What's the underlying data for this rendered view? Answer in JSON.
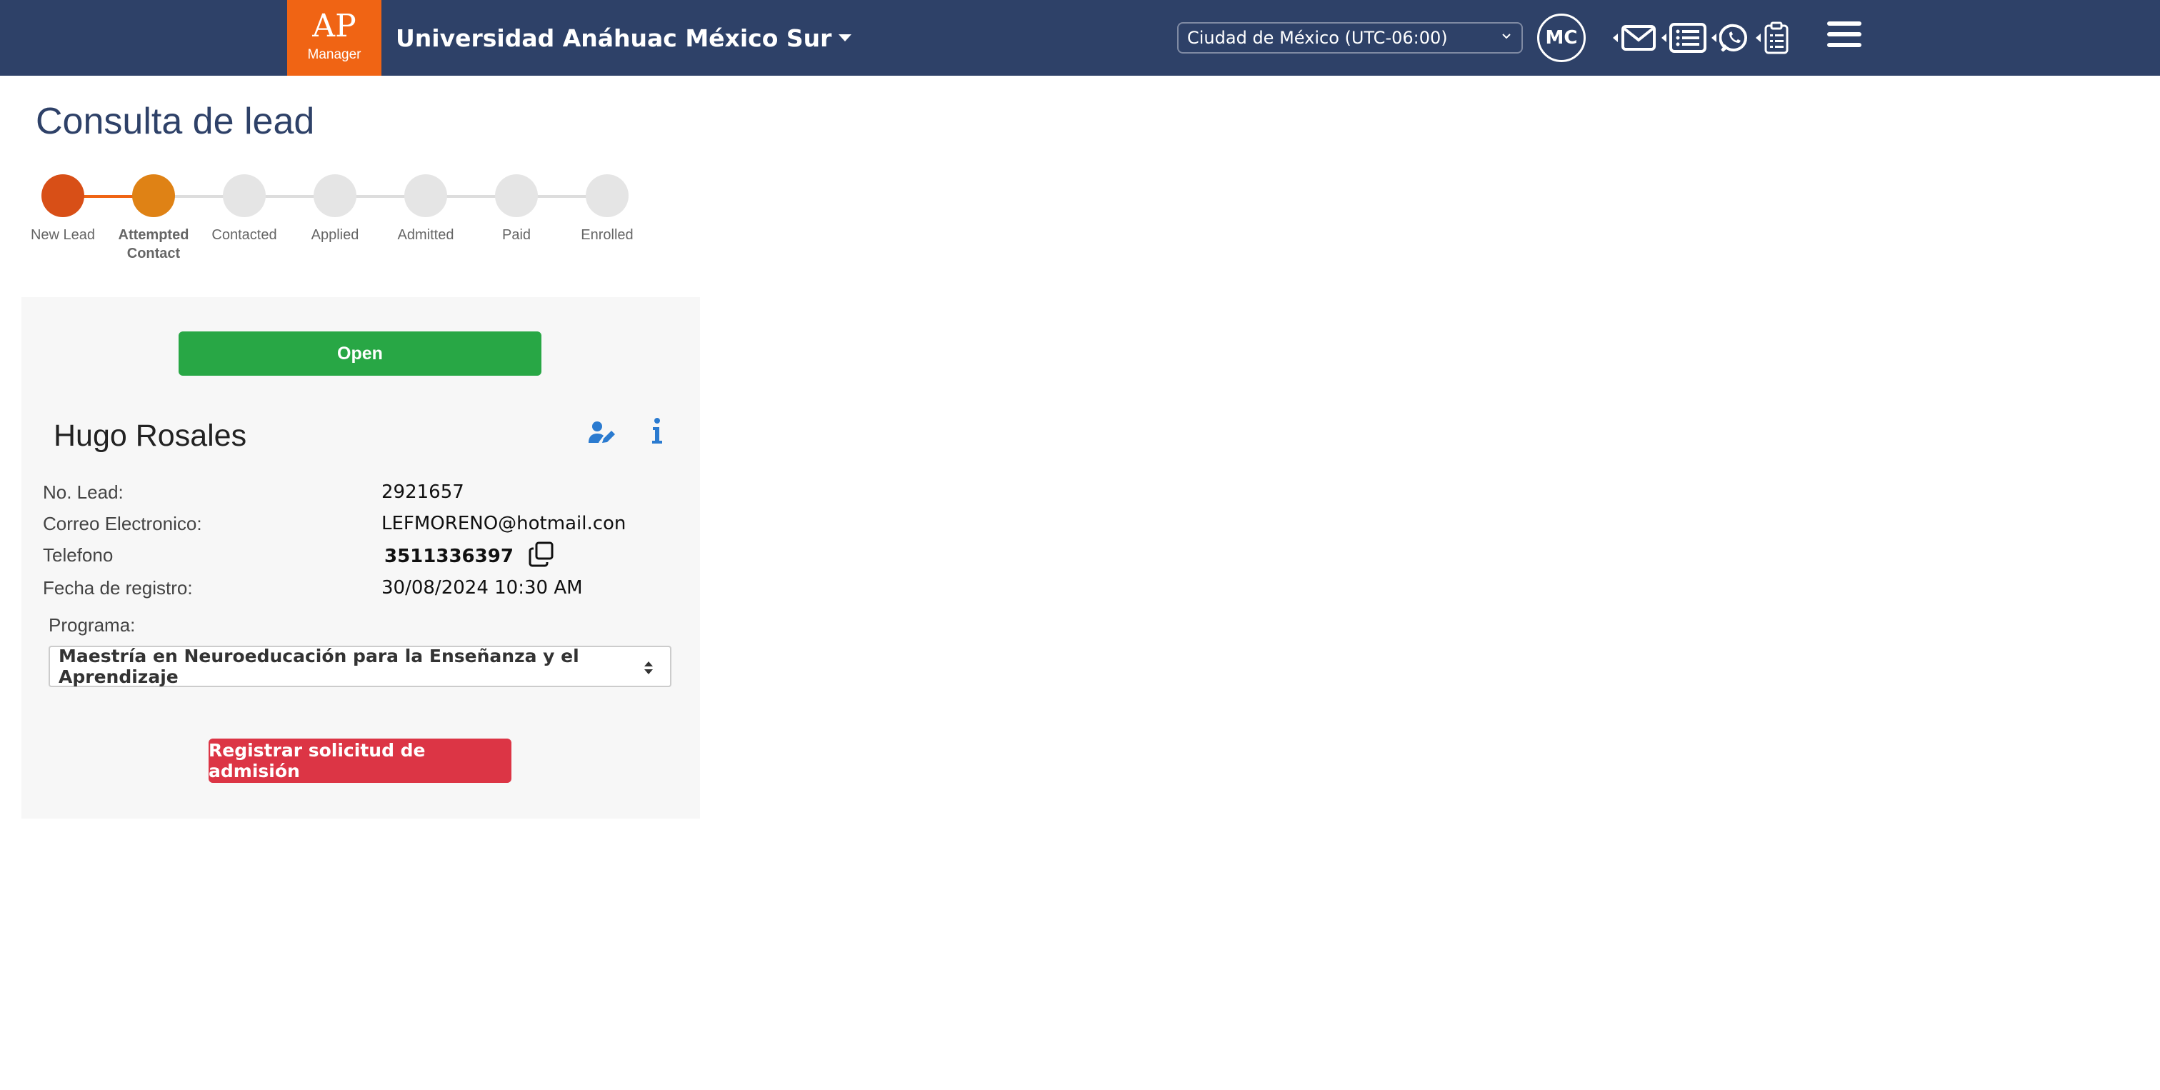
{
  "navbar": {
    "logo_text": "AP",
    "logo_sub": "Manager",
    "institution": "Universidad Anáhuac México Sur",
    "timezone": "Ciudad de México (UTC-06:00)",
    "avatar_initials": "MC",
    "icons": [
      "mail-icon",
      "list-icon",
      "whatsapp-icon",
      "clipboard-icon",
      "hamburger-menu-icon"
    ],
    "bg_color": "#2e4168",
    "logo_color": "#f06414"
  },
  "page": {
    "title": "Consulta de lead"
  },
  "stepper": {
    "current_index": 1,
    "steps": [
      {
        "label": "New Lead",
        "color": "#d84f17"
      },
      {
        "label": "Attempted Contact",
        "color": "#df8215"
      },
      {
        "label": "Contacted",
        "color": "#e5e5e5"
      },
      {
        "label": "Applied",
        "color": "#e5e5e5"
      },
      {
        "label": "Admitted",
        "color": "#e5e5e5"
      },
      {
        "label": "Paid",
        "color": "#e5e5e5"
      },
      {
        "label": "Enrolled",
        "color": "#e5e5e5"
      }
    ],
    "active_line_color": "#f06414",
    "inactive_line_color": "#dddddd"
  },
  "lead": {
    "status_button": "Open",
    "name": "Hugo Rosales",
    "fields": [
      {
        "label": "No. Lead:",
        "value": "2921657"
      },
      {
        "label": "Correo Electronico:",
        "value": "LEFMORENO@hotmail.con"
      },
      {
        "label": "Telefono",
        "value": "3511336397"
      },
      {
        "label": "Fecha de registro:",
        "value": "30/08/2024 10:30 AM"
      }
    ],
    "programa_label": "Programa:",
    "programa_value": "Maestría en Neuroeducación para la Enseñanza y el Aprendizaje",
    "register_button": "Registrar solicitud de admisión"
  }
}
